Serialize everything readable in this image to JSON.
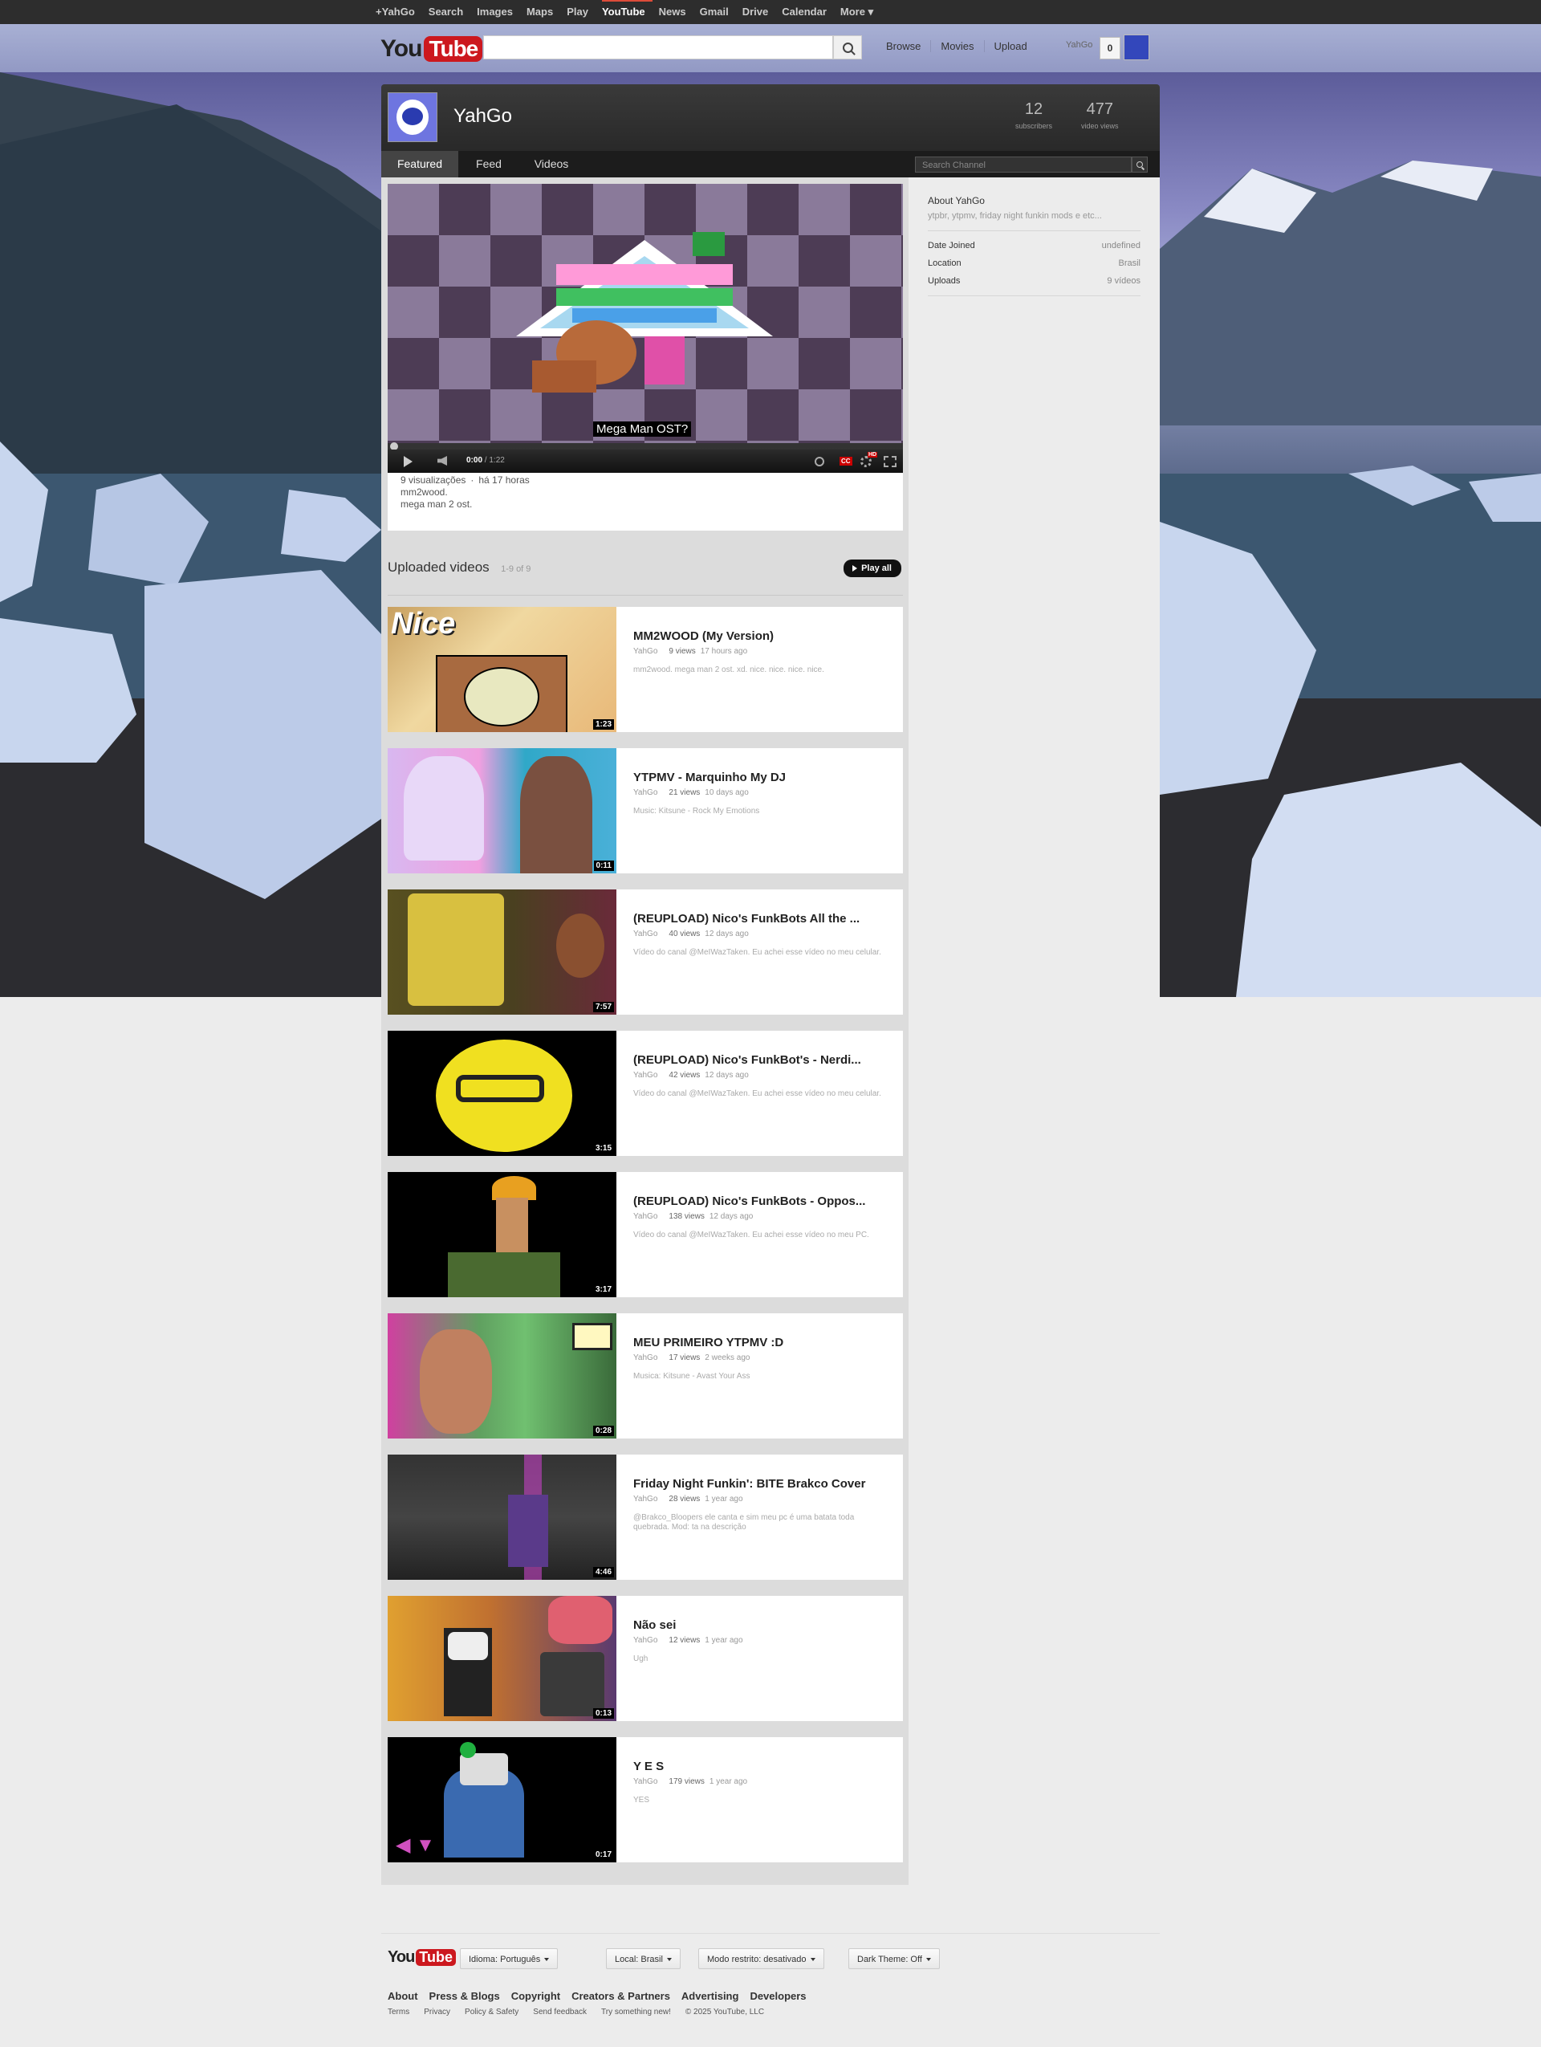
{
  "google_bar": {
    "items": [
      "+YahGo",
      "Search",
      "Images",
      "Maps",
      "Play",
      "YouTube",
      "News",
      "Gmail",
      "Drive",
      "Calendar",
      "More ▾"
    ],
    "active": "YouTube"
  },
  "masthead": {
    "logo_you": "You",
    "logo_tube": "Tube",
    "search_value": "",
    "links": [
      "Browse",
      "Movies",
      "Upload"
    ],
    "username": "YahGo",
    "notification_count": "0"
  },
  "channel": {
    "name": "YahGo",
    "subscribers": "12",
    "subscribers_label": "subscribers",
    "views": "477",
    "views_label": "video views",
    "tabs": [
      "Featured",
      "Feed",
      "Videos"
    ],
    "active_tab": "Featured",
    "search_placeholder": "Search Channel"
  },
  "featured": {
    "caption": "Mega Man OST?",
    "time_current": "0:00",
    "time_total": "/ 1:22",
    "views": "9 visualizações",
    "age": "há 17 horas",
    "desc_line1": "mm2wood.",
    "desc_line2": "mega man 2 ost."
  },
  "uploads": {
    "title": "Uploaded videos",
    "count": "1-9 of 9",
    "play_all": "Play all",
    "videos": [
      {
        "title": "MM2WOOD (My Version)",
        "author": "YahGo",
        "views": "9 views",
        "age": "17 hours ago",
        "desc": "mm2wood. mega man 2 ost. xd. nice. nice. nice. nice.",
        "duration": "1:23",
        "thumb_overlay": "Nice"
      },
      {
        "title": "YTPMV - Marquinho My DJ",
        "author": "YahGo",
        "views": "21 views",
        "age": "10 days ago",
        "desc": "Music: Kitsune - Rock My Emotions",
        "duration": "0:11"
      },
      {
        "title": "(REUPLOAD) Nico's FunkBots All the ...",
        "author": "YahGo",
        "views": "40 views",
        "age": "12 days ago",
        "desc": "Vídeo do canal @MeIWazTaken. Eu achei esse vídeo no meu celular.",
        "duration": "7:57"
      },
      {
        "title": "(REUPLOAD) Nico's FunkBot's - Nerdi...",
        "author": "YahGo",
        "views": "42 views",
        "age": "12 days ago",
        "desc": "Vídeo do canal @MeIWazTaken. Eu achei esse vídeo no meu celular.",
        "duration": "3:15"
      },
      {
        "title": "(REUPLOAD) Nico's FunkBots - Oppos...",
        "author": "YahGo",
        "views": "138 views",
        "age": "12 days ago",
        "desc": "Vídeo do canal @MeIWazTaken. Eu achei esse vídeo no meu PC.",
        "duration": "3:17"
      },
      {
        "title": "MEU PRIMEIRO YTPMV :D",
        "author": "YahGo",
        "views": "17 views",
        "age": "2 weeks ago",
        "desc": "Musica: Kitsune - Avast Your Ass",
        "duration": "0:28"
      },
      {
        "title": "Friday Night Funkin': BITE Brakco Cover",
        "author": "YahGo",
        "views": "28 views",
        "age": "1 year ago",
        "desc": "@Brakco_Bloopers ele canta e sim meu pc é uma batata toda quebrada. Mod: ta na descrição",
        "duration": "4:46"
      },
      {
        "title": "Não sei",
        "author": "YahGo",
        "views": "12 views",
        "age": "1 year ago",
        "desc": "Ugh",
        "duration": "0:13"
      },
      {
        "title": "Y E S",
        "author": "YahGo",
        "views": "179 views",
        "age": "1 year ago",
        "desc": "YES",
        "duration": "0:17"
      }
    ]
  },
  "about": {
    "title": "About YahGo",
    "desc": "ytpbr, ytpmv, friday night funkin mods e etc...",
    "rows": [
      {
        "label": "Date Joined",
        "value": "undefined"
      },
      {
        "label": "Location",
        "value": "Brasil"
      },
      {
        "label": "Uploads",
        "value": "9 vídeos"
      }
    ]
  },
  "footer": {
    "logo_you": "You",
    "logo_tube": "Tube",
    "buttons": [
      "Idioma: Português",
      "Local: Brasil",
      "Modo restrito: desativado",
      "Dark Theme: Off"
    ],
    "links": [
      "About",
      "Press & Blogs",
      "Copyright",
      "Creators & Partners",
      "Advertising",
      "Developers"
    ],
    "small_links": [
      "Terms",
      "Privacy",
      "Policy & Safety",
      "Send feedback",
      "Try something new!"
    ],
    "copyright": "© 2025 YouTube, LLC"
  },
  "colors": {
    "brand_red": "#cc181e",
    "masthead": "#9ea5cc",
    "channel_header": "#2b2b2b"
  }
}
